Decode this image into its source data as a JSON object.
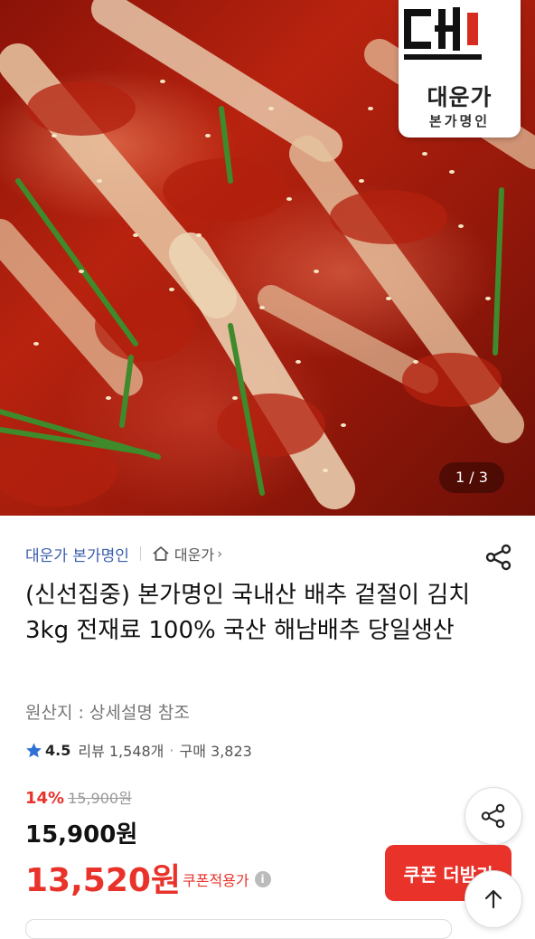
{
  "hero": {
    "image_alt": "kimchi-photo",
    "counter": "1 / 3",
    "logo": {
      "name": "대운가",
      "sub": "본가명인"
    }
  },
  "brand": {
    "name": "대운가 본가명인",
    "store": "대운가"
  },
  "product": {
    "title": "(신선집중) 본가명인 국내산 배추 겉절이 김치 3kg 전재료 100% 국산 해남배추 당일생산",
    "origin": "원산지 : 상세설명 참조"
  },
  "rating": {
    "score": "4.5",
    "reviews": "리뷰 1,548개",
    "sep": "·",
    "purchases": "구매 3,823"
  },
  "price": {
    "discount": "14%",
    "original": "15,900원",
    "sale": "15,900원",
    "coupon_price": "13,520원",
    "coupon_note": "쿠폰적용가"
  },
  "buttons": {
    "coupon": "쿠폰 더받기",
    "info": "i"
  },
  "icons": [
    "share-icon",
    "home-icon",
    "star-icon",
    "info-icon",
    "arrow-up-icon"
  ],
  "colors": {
    "accent": "#e8322a",
    "brand_link": "#3a5dae",
    "star": "#2f6fd6"
  }
}
